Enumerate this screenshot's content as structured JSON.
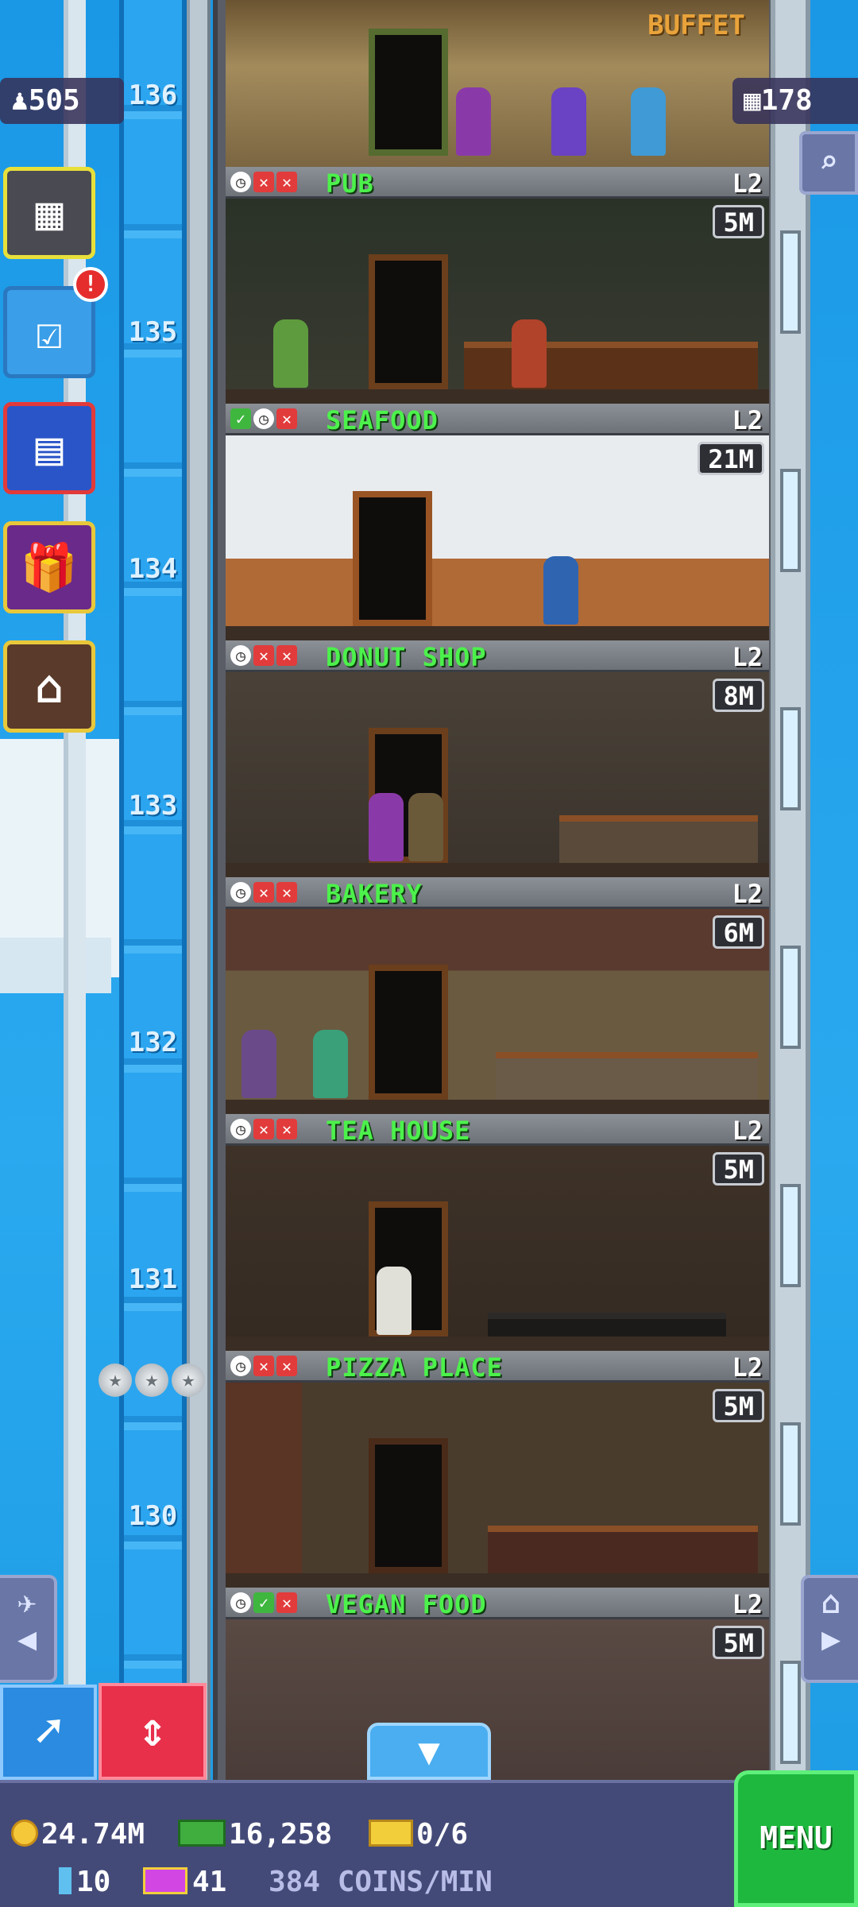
{
  "hud_top": {
    "population": "505",
    "population_icon": "person-icon",
    "floor_count": "178",
    "floor_icon": "building-icon"
  },
  "shaft": {
    "floor_numbers": [
      "136",
      "135",
      "134",
      "133",
      "132",
      "131",
      "130"
    ]
  },
  "top_floor": {
    "name": "BUFFET"
  },
  "floors": [
    {
      "name": "PUB",
      "level": "L2",
      "money": "5M",
      "status": [
        "clock",
        "x",
        "x"
      ]
    },
    {
      "name": "SEAFOOD",
      "level": "L2",
      "money": "21M",
      "status": [
        "ok",
        "clock",
        "x"
      ]
    },
    {
      "name": "DONUT SHOP",
      "level": "L2",
      "money": "8M",
      "status": [
        "clock",
        "x",
        "x"
      ]
    },
    {
      "name": "BAKERY",
      "level": "L2",
      "money": "6M",
      "status": [
        "clock",
        "x",
        "x"
      ]
    },
    {
      "name": "TEA HOUSE",
      "level": "L2",
      "money": "5M",
      "status": [
        "clock",
        "x",
        "x"
      ]
    },
    {
      "name": "PIZZA PLACE",
      "level": "L2",
      "money": "5M",
      "status": [
        "clock",
        "x",
        "x"
      ]
    },
    {
      "name": "VEGAN FOOD",
      "level": "L2",
      "money": "5M",
      "status": [
        "clock",
        "ok",
        "x"
      ]
    }
  ],
  "side_menu": [
    {
      "name": "tower-overview-icon"
    },
    {
      "name": "missions-checklist-icon"
    },
    {
      "name": "calendar-icon"
    },
    {
      "name": "gift-icon"
    },
    {
      "name": "market-stall-icon"
    }
  ],
  "alert_badge": "!",
  "hud_bottom": {
    "coins": "24.74M",
    "bux": "16,258",
    "tickets": "0/6",
    "gems": "10",
    "vip": "41",
    "income": "384 COINS/MIN"
  },
  "menu_label": "MENU",
  "colors": {
    "floor_name": "#4cf14b",
    "menu": "#1fb83f",
    "lift_button": "#e8304a"
  }
}
